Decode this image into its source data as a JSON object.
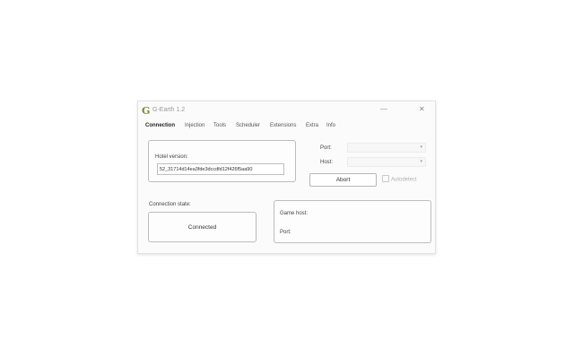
{
  "window": {
    "logo_letter": "G",
    "title": "G-Earth 1.2",
    "minimize_glyph": "—",
    "close_glyph": "✕"
  },
  "tabs": [
    {
      "label": "Connection",
      "active": true
    },
    {
      "label": "Injection",
      "active": false
    },
    {
      "label": "Tools",
      "active": false
    },
    {
      "label": "Scheduler",
      "active": false
    },
    {
      "label": "Extensions",
      "active": false
    },
    {
      "label": "Extra",
      "active": false
    },
    {
      "label": "Info",
      "active": false
    }
  ],
  "connection": {
    "hotel_version_label": "Hotel version:",
    "hotel_version_value": "52_31714d14ea3fde3dccdfd12f426f5aa90",
    "port_label": "Port:",
    "port_value": "",
    "host_label": "Host:",
    "host_value": "",
    "abort_label": "Abort",
    "autodetect_label": "Autodetect",
    "autodetect_checked": false,
    "state_label": "Connection state:",
    "state_value": "Connected",
    "game_host_label": "Game host:",
    "game_port_label": "Port:"
  },
  "icons": {
    "dropdown_arrow": "chevron-down-icon"
  }
}
